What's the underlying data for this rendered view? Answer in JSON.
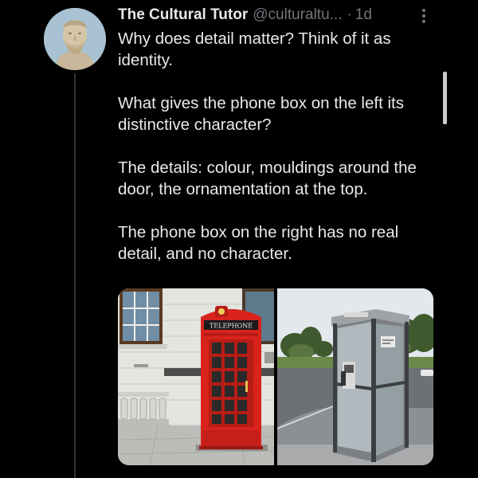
{
  "tweet": {
    "display_name": "The Cultural Tutor",
    "handle": "@culturaltu...",
    "separator": "·",
    "time": "1d",
    "paragraphs": [
      "Why does detail matter? Think of it as identity.",
      "What gives the phone box on the left its distinctive character?",
      "The details: colour, mouldings around the door, the ornamentation at the top.",
      "The phone box on the right has no real detail, and no character."
    ]
  },
  "media": {
    "left_sign_text": "TELEPHONE",
    "left_icon": "red-telephone-box-photo",
    "right_icon": "modern-glass-phone-box-photo"
  },
  "colors": {
    "background": "#000000",
    "text": "#e7e9ea",
    "secondary_text": "#71767b",
    "phone_box_red": "#d8231c"
  }
}
